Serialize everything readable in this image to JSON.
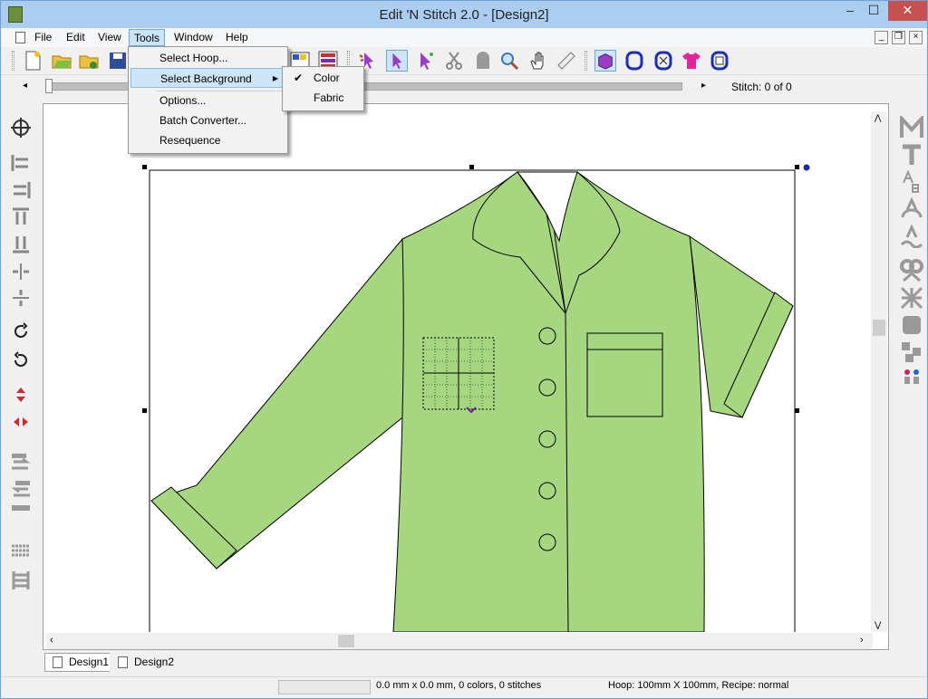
{
  "window": {
    "title": "Edit 'N Stitch 2.0 - [Design2]",
    "minimize_glyph": "–",
    "maximize_glyph": "☐",
    "close_glyph": "✕"
  },
  "menubar": {
    "items": [
      {
        "label": "File"
      },
      {
        "label": "Edit"
      },
      {
        "label": "View"
      },
      {
        "label": "Tools"
      },
      {
        "label": "Window"
      },
      {
        "label": "Help"
      }
    ],
    "mdi": {
      "minimize": "_",
      "restore": "❐",
      "close": "×"
    }
  },
  "tools_menu": {
    "items": [
      {
        "label": "Select Hoop..."
      },
      {
        "label": "Select Background"
      },
      {
        "label": "Options..."
      },
      {
        "label": "Batch Converter..."
      },
      {
        "label": "Resequence"
      }
    ],
    "submenu_arrow": "▶",
    "background_submenu": [
      {
        "label": "Color",
        "check": "✔"
      },
      {
        "label": "Fabric",
        "check": ""
      }
    ]
  },
  "slider": {
    "stitch_label": "Stitch:  0 of 0",
    "left_arrow": "◂",
    "right_arrow": "▸"
  },
  "tabs": [
    {
      "label": "Design1"
    },
    {
      "label": "Design2"
    }
  ],
  "status": {
    "dimensions": "0.0 mm x 0.0 mm, 0 colors, 0 stitches",
    "hoop": "Hoop: 100mm X 100mm, Recipe: normal"
  },
  "colors": {
    "shirt": "#a6d67f",
    "accent": "#9b3cc9",
    "title_bg": "#aacdf0"
  }
}
